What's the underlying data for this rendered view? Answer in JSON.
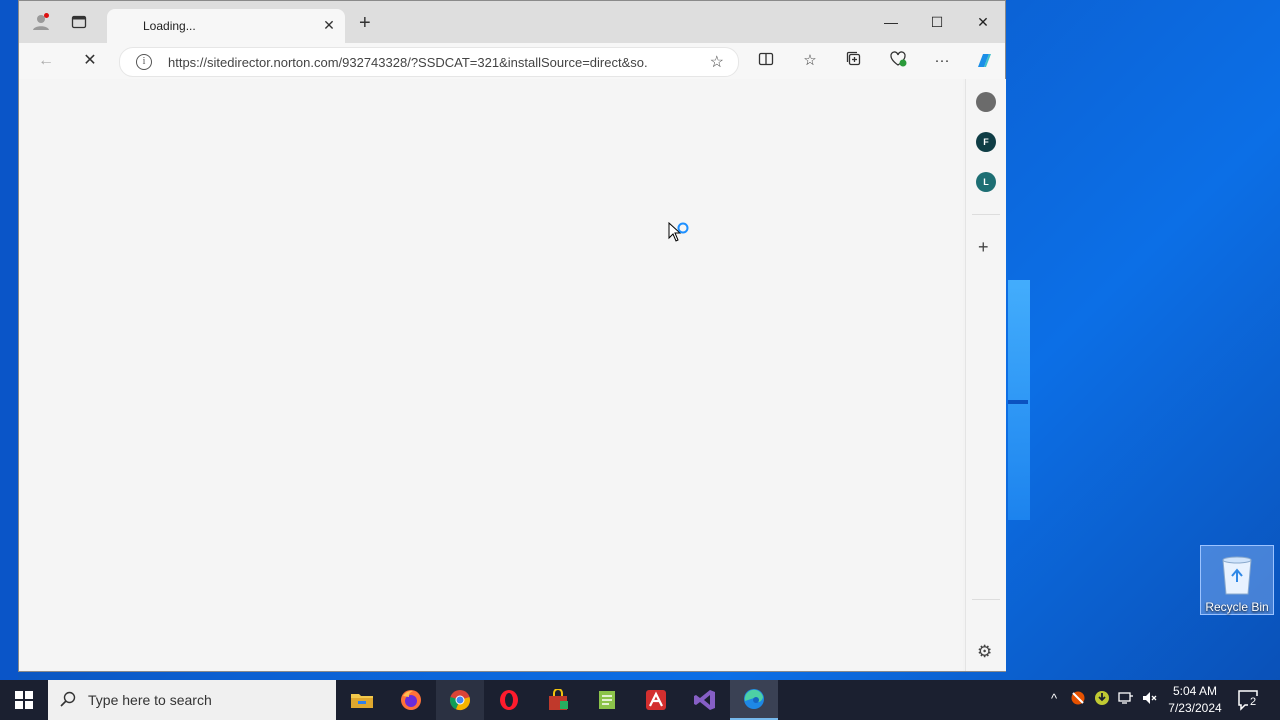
{
  "browser": {
    "tab": {
      "title": "Loading..."
    },
    "address": {
      "url": "https://sitedirector.norton.com/932743328/?SSDCAT=321&installSource=direct&so..."
    },
    "sidebar": {
      "avatars": [
        {
          "letter": "",
          "color": "#6b6b6b"
        },
        {
          "letter": "F",
          "color": "#0f3d45"
        },
        {
          "letter": "L",
          "color": "#1d6e73"
        }
      ]
    }
  },
  "desktop": {
    "recycle_bin_label": "Recycle Bin"
  },
  "taskbar": {
    "search_placeholder": "Type here to search",
    "time": "5:04 AM",
    "date": "7/23/2024",
    "notification_count": "2",
    "apps": [
      "file-explorer",
      "firefox",
      "chrome",
      "opera",
      "app-bag",
      "notepad-plus",
      "avira",
      "visual-studio",
      "edge"
    ]
  }
}
